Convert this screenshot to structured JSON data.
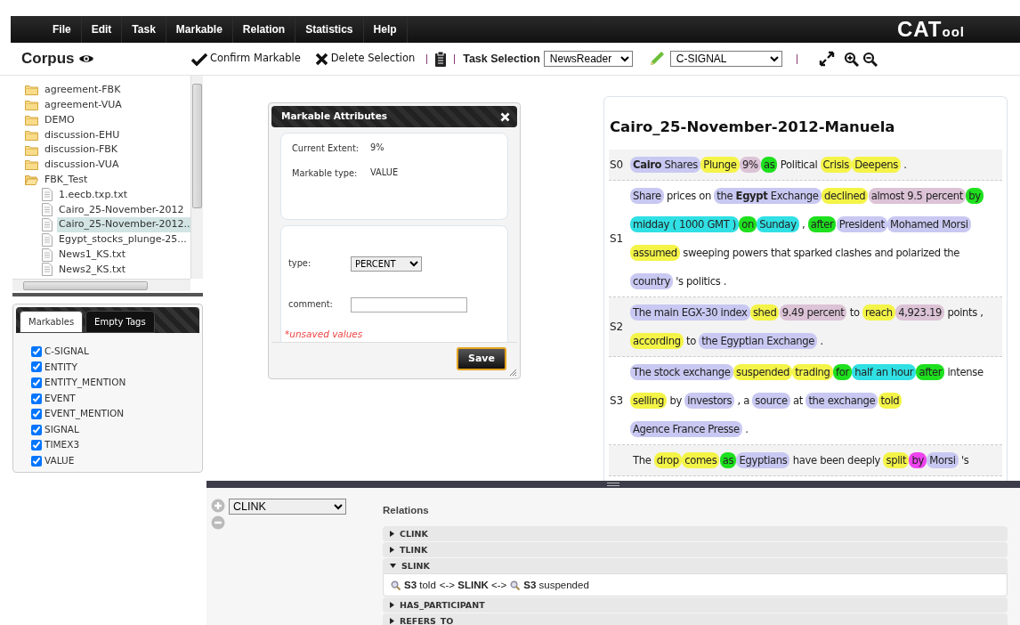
{
  "menu": [
    {
      "label": "File"
    },
    {
      "label": "Edit"
    },
    {
      "label": "Task"
    },
    {
      "label": "Markable"
    },
    {
      "label": "Relation"
    },
    {
      "label": "Statistics"
    },
    {
      "label": "Help"
    }
  ],
  "logo": {
    "main": "CAT",
    "suffix": "ool"
  },
  "toolbar": {
    "corpus_title": "Corpus",
    "confirm": "Confirm Markable",
    "delete": "Delete Selection",
    "task_label": "Task Selection",
    "task_value": "NewsReader",
    "markable_value": "C-SIGNAL"
  },
  "tree": [
    {
      "kind": "folder",
      "label": "agreement-FBK",
      "expanded": false
    },
    {
      "kind": "folder",
      "label": "agreement-VUA",
      "expanded": false
    },
    {
      "kind": "folder",
      "label": "DEMO",
      "expanded": false
    },
    {
      "kind": "folder",
      "label": "discussion-EHU",
      "expanded": false
    },
    {
      "kind": "folder",
      "label": "discussion-FBK",
      "expanded": false
    },
    {
      "kind": "folder",
      "label": "discussion-VUA",
      "expanded": false
    },
    {
      "kind": "folder",
      "label": "FBK_Test",
      "expanded": true,
      "children": [
        {
          "kind": "file",
          "label": "1.eecb.txp.txt",
          "selected": false
        },
        {
          "kind": "file",
          "label": "Cairo_25-November-2012",
          "selected": false
        },
        {
          "kind": "file",
          "label": "Cairo_25-November-2012..",
          "selected": true
        },
        {
          "kind": "file",
          "label": "Egypt_stocks_plunge-25...",
          "selected": false
        },
        {
          "kind": "file",
          "label": "News1_KS.txt",
          "selected": false
        },
        {
          "kind": "file",
          "label": "News2_KS.txt",
          "selected": false
        }
      ]
    }
  ],
  "markables_panel": {
    "tabs": [
      {
        "label": "Markables",
        "selected": true
      },
      {
        "label": "Empty Tags",
        "selected": false
      }
    ],
    "items": [
      {
        "label": "C-SIGNAL",
        "checked": true
      },
      {
        "label": "ENTITY",
        "checked": true
      },
      {
        "label": "ENTITY_MENTION",
        "checked": true
      },
      {
        "label": "EVENT",
        "checked": true
      },
      {
        "label": "EVENT_MENTION",
        "checked": true
      },
      {
        "label": "SIGNAL",
        "checked": true
      },
      {
        "label": "TIMEX3",
        "checked": true
      },
      {
        "label": "VALUE",
        "checked": true
      }
    ]
  },
  "dialog": {
    "title": "Markable Attributes",
    "info": [
      {
        "label": "Current Extent:",
        "value": "9%"
      },
      {
        "label": "Markable type:",
        "value": "VALUE"
      }
    ],
    "fields": [
      {
        "kind": "select",
        "label": "type:",
        "value": "PERCENT"
      },
      {
        "kind": "text",
        "label": "comment:"
      }
    ],
    "warning": "*unsaved values",
    "save": "Save"
  },
  "document": {
    "title": "Cairo_25-November-2012-Manuela",
    "sentences": [
      {
        "label": "S0",
        "segments": [
          {
            "kind": "entity",
            "text": "**Cairo** Shares"
          },
          {
            "kind": "event",
            "text": "Plunge"
          },
          {
            "kind": "value",
            "text": "9%"
          },
          {
            "kind": "signal",
            "text": "as"
          },
          {
            "kind": "plain",
            "text": "Political"
          },
          {
            "kind": "event",
            "text": "Crisis"
          },
          {
            "kind": "event",
            "text": "Deepens"
          },
          {
            "kind": "plain",
            "text": "."
          }
        ]
      },
      {
        "label": "S1",
        "segments": [
          {
            "kind": "entity",
            "text": "Share"
          },
          {
            "kind": "plain",
            "text": "prices on"
          },
          {
            "kind": "entity",
            "text": "the **Egypt** Exchange"
          },
          {
            "kind": "event",
            "text": "declined"
          },
          {
            "kind": "value",
            "text": "almost 9.5 percent"
          },
          {
            "kind": "signal",
            "text": "by"
          },
          {
            "kind": "timex",
            "text": "midday ( 1000 GMT )"
          },
          {
            "kind": "signal",
            "text": "on"
          },
          {
            "kind": "timex",
            "text": "Sunday"
          },
          {
            "kind": "plain",
            "text": ","
          },
          {
            "kind": "signal",
            "text": "after"
          },
          {
            "kind": "entity",
            "text": "President"
          },
          {
            "kind": "entity",
            "text": "Mohamed Morsi"
          },
          {
            "kind": "event",
            "text": "assumed"
          },
          {
            "kind": "plain",
            "text": "sweeping powers that sparked clashes and polarized the"
          },
          {
            "kind": "entity",
            "text": "country"
          },
          {
            "kind": "plain",
            "text": "'s politics ."
          }
        ]
      },
      {
        "label": "S2",
        "segments": [
          {
            "kind": "entity",
            "text": "The main EGX-30 index"
          },
          {
            "kind": "event",
            "text": "shed"
          },
          {
            "kind": "value",
            "text": "9.49 percent"
          },
          {
            "kind": "plain",
            "text": "to"
          },
          {
            "kind": "event",
            "text": "reach"
          },
          {
            "kind": "value",
            "text": "4,923.19"
          },
          {
            "kind": "plain",
            "text": "points ,"
          },
          {
            "kind": "event",
            "text": "according"
          },
          {
            "kind": "plain",
            "text": "to"
          },
          {
            "kind": "entity",
            "text": "the Egyptian Exchange"
          },
          {
            "kind": "plain",
            "text": "."
          }
        ]
      },
      {
        "label": "S3",
        "segments": [
          {
            "kind": "entity",
            "text": "The stock exchange"
          },
          {
            "kind": "event",
            "text": "suspended"
          },
          {
            "kind": "event",
            "text": "trading"
          },
          {
            "kind": "signal",
            "text": "for"
          },
          {
            "kind": "timex",
            "text": "half an hour"
          },
          {
            "kind": "signal",
            "text": "after"
          },
          {
            "kind": "plain",
            "text": "intense"
          },
          {
            "kind": "event",
            "text": "selling"
          },
          {
            "kind": "plain",
            "text": "by"
          },
          {
            "kind": "entity",
            "text": "investors"
          },
          {
            "kind": "plain",
            "text": ", a"
          },
          {
            "kind": "entity",
            "text": "source"
          },
          {
            "kind": "plain",
            "text": "at"
          },
          {
            "kind": "entity",
            "text": "the exchange"
          },
          {
            "kind": "event",
            "text": "told"
          },
          {
            "kind": "entity",
            "text": "Agence France Presse"
          },
          {
            "kind": "plain",
            "text": "."
          }
        ]
      },
      {
        "segments": [
          {
            "kind": "plain",
            "text": "The"
          },
          {
            "kind": "event",
            "text": "drop"
          },
          {
            "kind": "event",
            "text": "comes"
          },
          {
            "kind": "signal",
            "text": "as"
          },
          {
            "kind": "entity",
            "text": "Egyptians"
          },
          {
            "kind": "plain",
            "text": "have been deeply"
          },
          {
            "kind": "event",
            "text": "split"
          },
          {
            "kind": "csignal",
            "text": "by"
          },
          {
            "kind": "entity",
            "text": "Morsi"
          },
          {
            "kind": "plain",
            "text": "'s"
          }
        ]
      }
    ]
  },
  "relations_panel": {
    "type_value": "CLINK",
    "title": "Relations",
    "groups": [
      {
        "label": "CLINK",
        "expanded": false
      },
      {
        "label": "TLINK",
        "expanded": false
      },
      {
        "label": "SLINK",
        "expanded": true,
        "items": [
          {
            "source": "**S3** told",
            "link": "<-> **SLINK** <->",
            "target": "**S3** suspended"
          }
        ]
      },
      {
        "label": "HAS_PARTICIPANT",
        "expanded": false
      },
      {
        "label": "REFERS_TO",
        "expanded": false
      }
    ]
  }
}
